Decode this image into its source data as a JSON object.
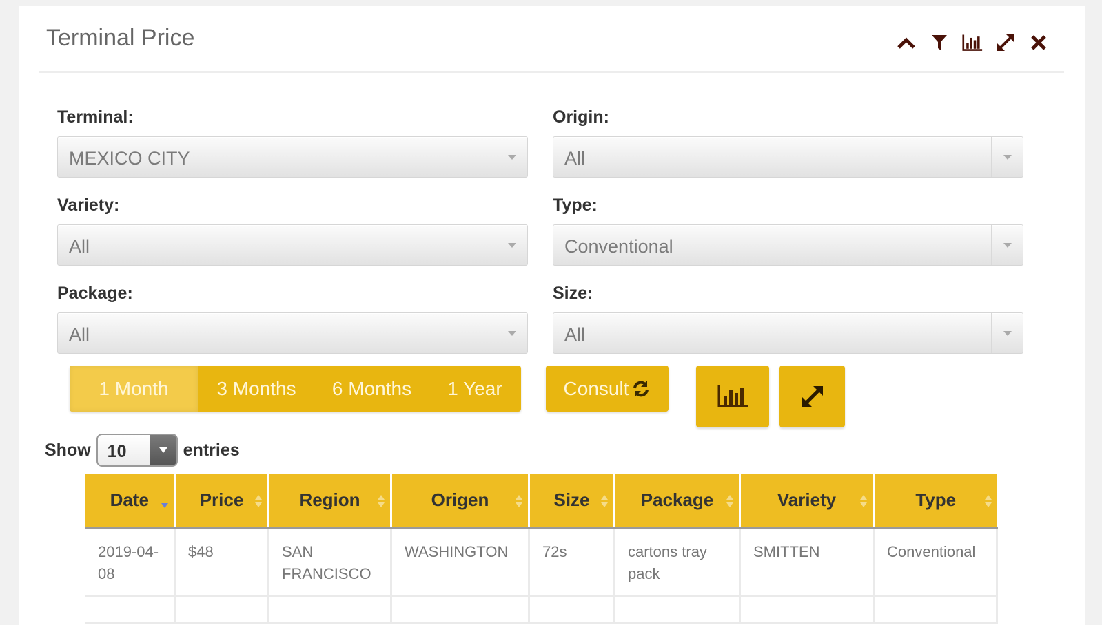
{
  "panel": {
    "title": "Terminal Price",
    "header_icons": [
      "chevron-up-icon",
      "filter-icon",
      "bar-chart-icon",
      "expand-icon",
      "close-icon"
    ]
  },
  "filters": {
    "terminal": {
      "label": "Terminal:",
      "value": "MEXICO CITY"
    },
    "origin": {
      "label": "Origin:",
      "value": "All"
    },
    "variety": {
      "label": "Variety:",
      "value": "All"
    },
    "type": {
      "label": "Type:",
      "value": "Conventional"
    },
    "package": {
      "label": "Package:",
      "value": "All"
    },
    "size": {
      "label": "Size:",
      "value": "All"
    }
  },
  "periods": {
    "active": "1 Month",
    "items": [
      "1 Month",
      "3 Months",
      "6 Months",
      "1 Year"
    ]
  },
  "actions": {
    "consult_label": "Consult"
  },
  "length_menu": {
    "prefix": "Show",
    "value": "10",
    "suffix": "entries"
  },
  "table": {
    "columns": [
      "Date",
      "Price",
      "Region",
      "Origen",
      "Size",
      "Package",
      "Variety",
      "Type"
    ],
    "sorted_column": "Date",
    "rows": [
      [
        "2019-04-08",
        "$48",
        "SAN FRANCISCO",
        "WASHINGTON",
        "72s",
        "cartons tray pack",
        "SMITTEN",
        "Conventional"
      ]
    ]
  },
  "colors": {
    "accent": "#e8b610",
    "header_bg": "#eebd22",
    "icon_dark": "#5a1a10"
  }
}
